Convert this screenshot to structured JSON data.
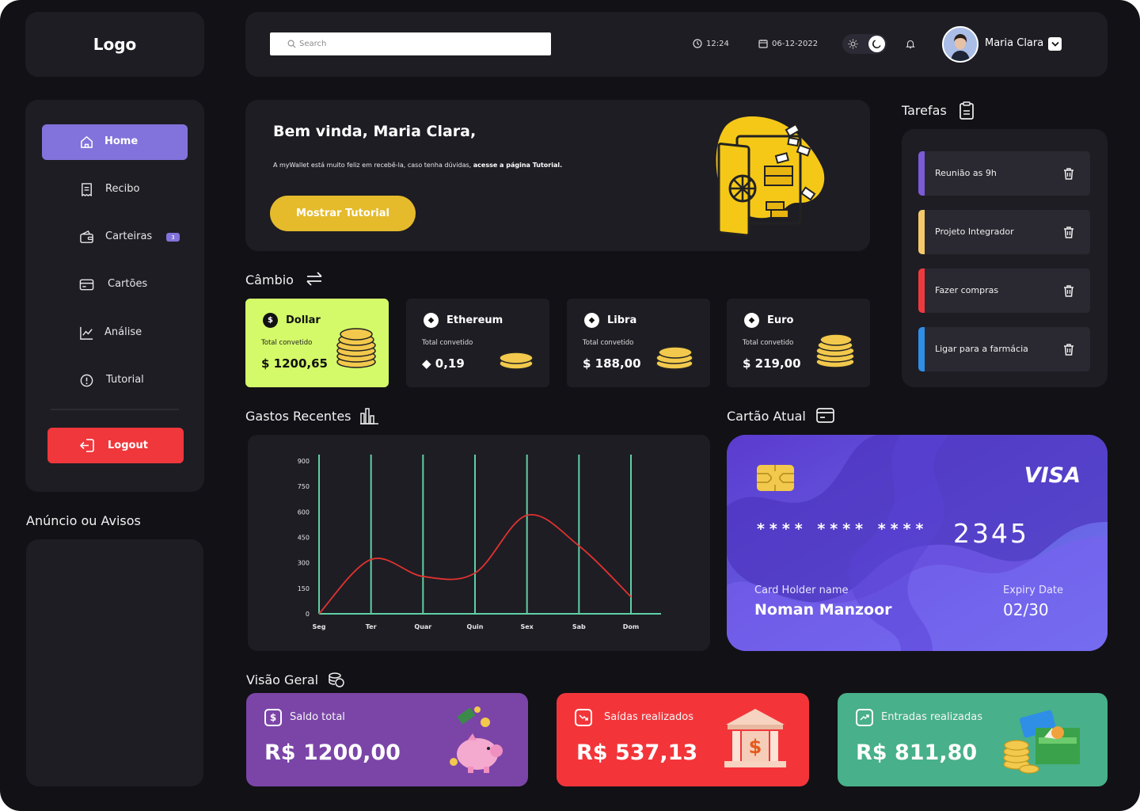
{
  "brand": {
    "logo": "Logo"
  },
  "topbar": {
    "search_placeholder": "Search",
    "time": "12:24",
    "date": "06-12-2022",
    "user_name": "Maria Clara"
  },
  "sidebar": {
    "items": [
      {
        "label": "Home",
        "icon": "home-icon"
      },
      {
        "label": "Recibo",
        "icon": "receipt-icon"
      },
      {
        "label": "Carteiras",
        "icon": "wallet-icon",
        "badge": "3"
      },
      {
        "label": "Cartões",
        "icon": "card-icon"
      },
      {
        "label": "Análise",
        "icon": "chart-line-icon"
      },
      {
        "label": "Tutorial",
        "icon": "info-icon"
      }
    ],
    "logout_label": "Logout",
    "ads_title": "Anúncio ou Avisos"
  },
  "welcome": {
    "title": "Bem vinda, Maria Clara,",
    "text": "A myWallet está muito feliz em recebê-la, caso tenha dúvidas, ",
    "text_bold": "acesse a página Tutorial.",
    "button": "Mostrar Tutorial"
  },
  "cambio": {
    "title": "Câmbio",
    "cards": [
      {
        "name": "Dollar",
        "symbol": "$",
        "sub": "Total convetido",
        "value": "$ 1200,65",
        "highlight": true
      },
      {
        "name": "Ethereum",
        "symbol": "◆",
        "sub": "Total convetido",
        "value": "◆ 0,19"
      },
      {
        "name": "Libra",
        "symbol": "◆",
        "sub": "Total convetido",
        "value": "$ 188,00"
      },
      {
        "name": "Euro",
        "symbol": "◆",
        "sub": "Total convetido",
        "value": "$ 219,00"
      }
    ]
  },
  "tarefas": {
    "title": "Tarefas",
    "items": [
      {
        "label": "Reunião as 9h",
        "color": "#7b5bd6"
      },
      {
        "label": "Projeto Integrador",
        "color": "#f4c96a"
      },
      {
        "label": "Fazer compras",
        "color": "#ee3a3e"
      },
      {
        "label": "Ligar para a farmácia",
        "color": "#2f8ee6"
      }
    ]
  },
  "gastos": {
    "title": "Gastos Recentes"
  },
  "chart_data": {
    "type": "line",
    "categories": [
      "Seg",
      "Ter",
      "Quar",
      "Quin",
      "Sex",
      "Sab",
      "Dom"
    ],
    "values": [
      0,
      320,
      220,
      240,
      580,
      400,
      100
    ],
    "ylim": [
      0,
      900
    ],
    "yticks": [
      0,
      150,
      300,
      450,
      600,
      750,
      900
    ],
    "line_color": "#e0322f",
    "gridline_color": "#5fcfa5",
    "grid": true
  },
  "cartao": {
    "title": "Cartão Atual",
    "brand": "VISA",
    "masked": "**** **** ****",
    "last4": "2345",
    "holder_label": "Card Holder name",
    "holder": "Noman Manzoor",
    "expiry_label": "Expiry Date",
    "expiry": "02/30"
  },
  "visao": {
    "title": "Visão Geral",
    "cards": [
      {
        "label": "Saldo total",
        "value": "R$ 1200,00",
        "color": "#7b45a8"
      },
      {
        "label": "Saídas realizados",
        "value": "R$ 537,13",
        "color": "#f3353a"
      },
      {
        "label": "Entradas realizadas",
        "value": "R$ 811,80",
        "color": "#48b08a"
      }
    ]
  }
}
